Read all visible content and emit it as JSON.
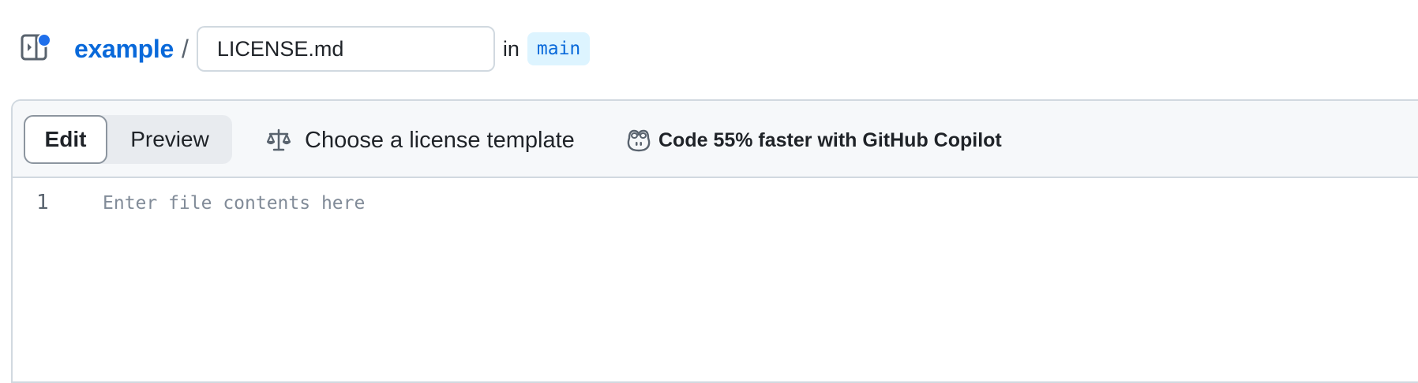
{
  "header": {
    "repo_name": "example",
    "separator": "/",
    "filename_value": "LICENSE.md",
    "in_label": "in",
    "branch_name": "main",
    "sidebar_toggle_icon": "sidebar-expand-icon",
    "notification_dot_color": "#1f6feb"
  },
  "toolbar": {
    "edit_label": "Edit",
    "preview_label": "Preview",
    "active_tab": "Edit",
    "license_template_label": "Choose a license template",
    "license_icon": "law-scale-icon",
    "copilot_label": "Code 55% faster with GitHub Copilot",
    "copilot_icon": "copilot-icon"
  },
  "editor": {
    "line_numbers": [
      "1"
    ],
    "placeholder": "Enter file contents here",
    "content": ""
  },
  "colors": {
    "link": "#0969da",
    "branch_bg": "#ddf4ff",
    "toolbar_bg": "#f6f8fa",
    "border": "#d1d9e0",
    "muted_text": "#818b98"
  }
}
